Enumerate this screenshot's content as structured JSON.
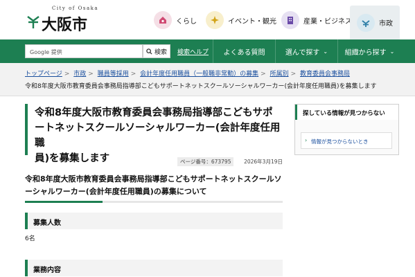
{
  "header": {
    "logo_small": "City of Osaka",
    "logo_text": "大阪市",
    "nav": [
      {
        "label": "くらし",
        "icon": "home-heart-icon",
        "color": "#f5dfe6",
        "fg": "#d04a73"
      },
      {
        "label": "イベント・観光",
        "icon": "sparkle-icon",
        "color": "#f8efcc",
        "fg": "#d2a316"
      },
      {
        "label": "産業・ビジネス",
        "icon": "building-icon",
        "color": "#e6e0f2",
        "fg": "#6a4aa8"
      },
      {
        "label": "市政",
        "icon": "city-icon",
        "color": "#d8e9f1",
        "fg": "#2d7fa8"
      }
    ]
  },
  "greenbar": {
    "search_placeholder": "Google 提供",
    "search_button": "検索",
    "help_link": "検索ヘルプ",
    "nav": [
      "よくある質問",
      "選んで探す",
      "組織から探す"
    ]
  },
  "breadcrumb": {
    "items": [
      "トップページ",
      "市政",
      "職員等採用",
      "会計年度任用職員（一般職非常勤）の募集",
      "所属別",
      "教育委員会事務局"
    ],
    "current": "令和8年度大阪市教育委員会事務局指導部こどもサポートネットスクールソーシャルワーカー(会計年度任用職員)を募集します"
  },
  "main": {
    "title_lines": [
      "令和8年度大阪市教育委員会事務局指導部こどもサポ",
      "ートネットスクールソーシャルワーカー(会計年度任用職",
      "員)を募集します"
    ],
    "page_number": "ページ番号：673795",
    "date": "2026年3月19日",
    "h2_lines": [
      "令和8年度大阪市教育委員会事務局指導部こどもサポートネットスクールソ",
      "ーシャルワーカー(会計年度任用職員)の募集について"
    ],
    "section1_heading": "募集人数",
    "section1_body": "6名",
    "section2_heading": "業務内容"
  },
  "sidebar": {
    "title": "探している情報が見つからない",
    "link": "情報が見つからないとき"
  }
}
